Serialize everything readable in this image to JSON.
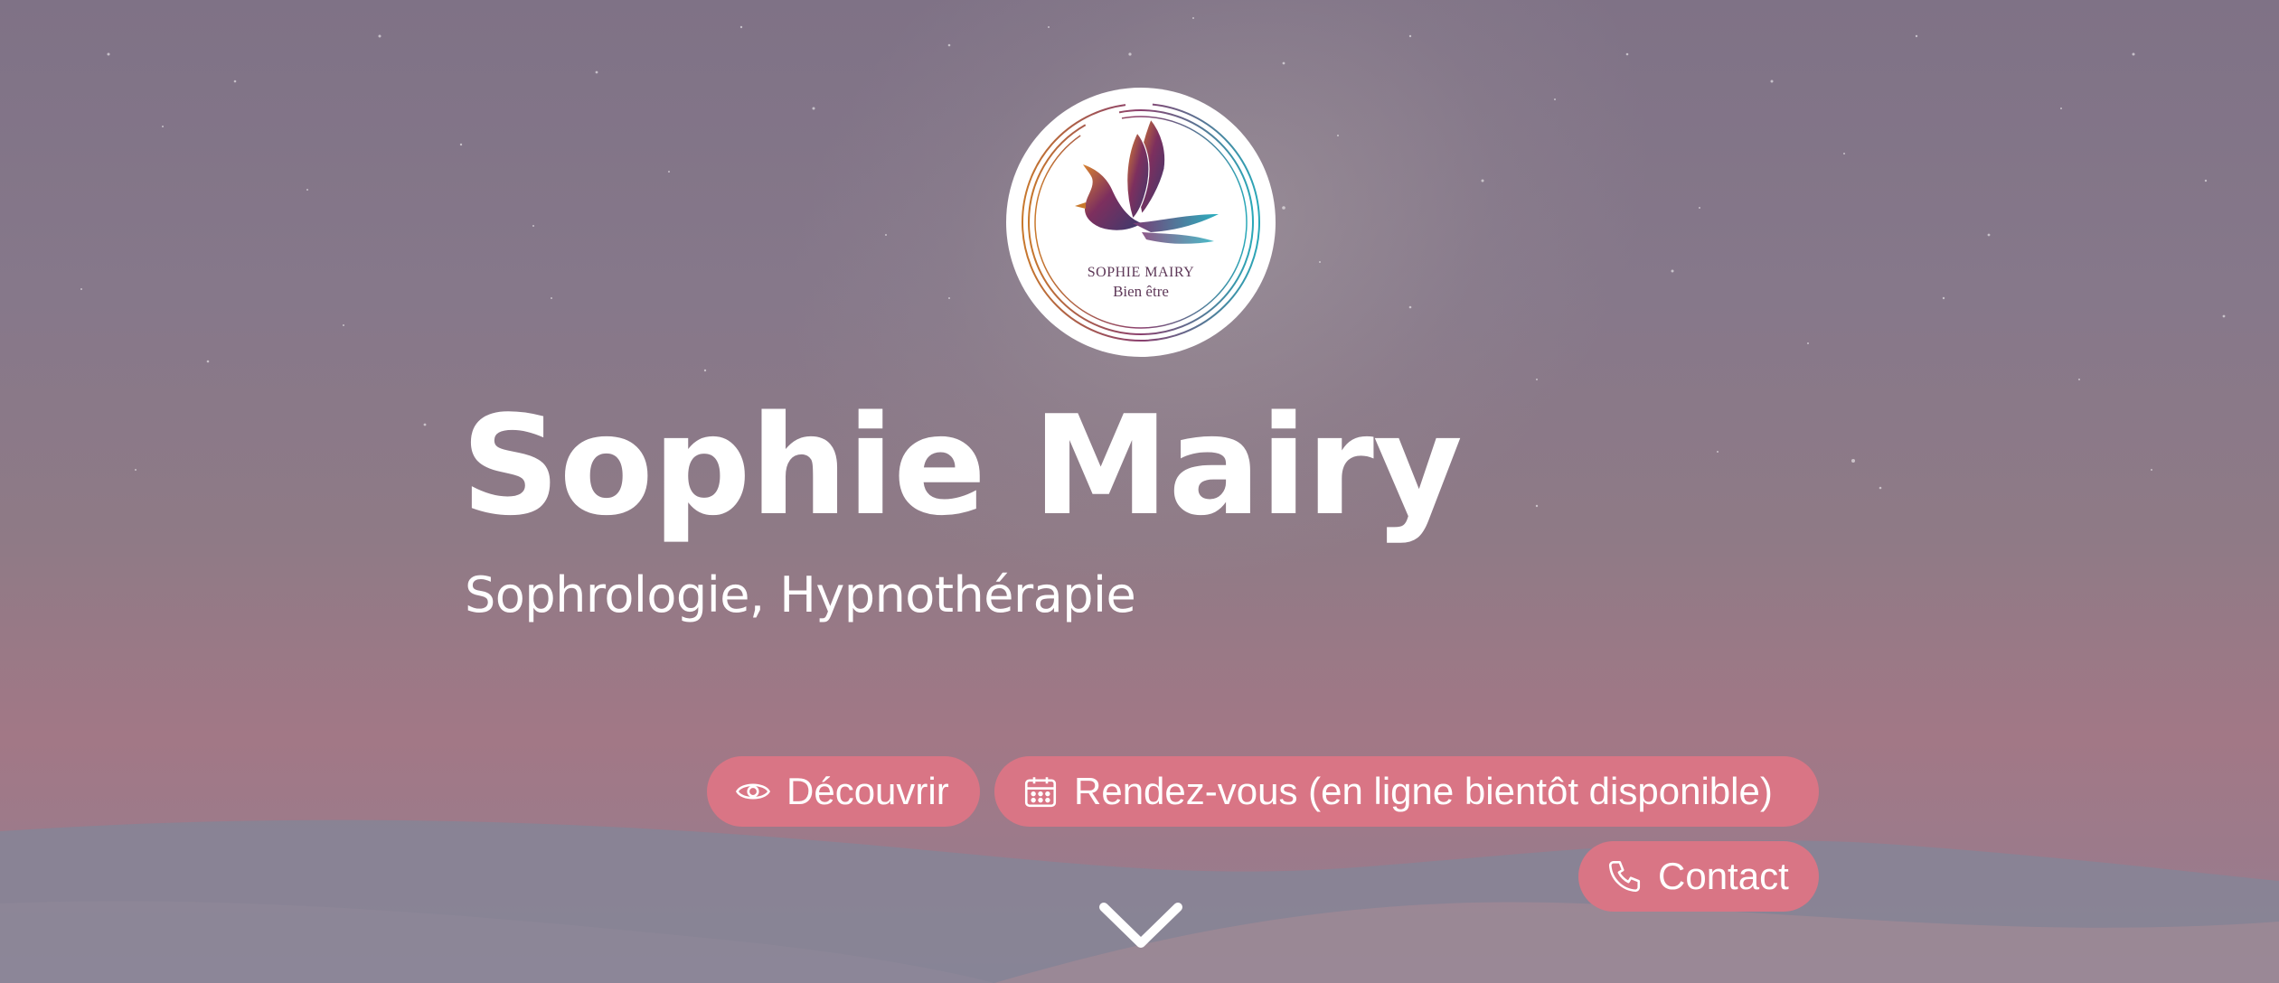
{
  "logo": {
    "line1": "SOPHIE MAIRY",
    "line2": "Bien être"
  },
  "hero": {
    "title": "Sophie Mairy",
    "subtitle": "Sophrologie, Hypnothérapie"
  },
  "buttons": {
    "discover": {
      "label": "Découvrir",
      "icon": "eye-icon"
    },
    "appointment": {
      "label": "Rendez-vous (en ligne bientôt disponible)",
      "icon": "calendar-icon"
    },
    "contact": {
      "label": "Contact",
      "icon": "phone-icon"
    }
  },
  "scroll": {
    "icon": "chevron-down-icon"
  },
  "colors": {
    "button_bg": "#d97585",
    "text": "#ffffff",
    "logo_text": "#5e3858"
  }
}
